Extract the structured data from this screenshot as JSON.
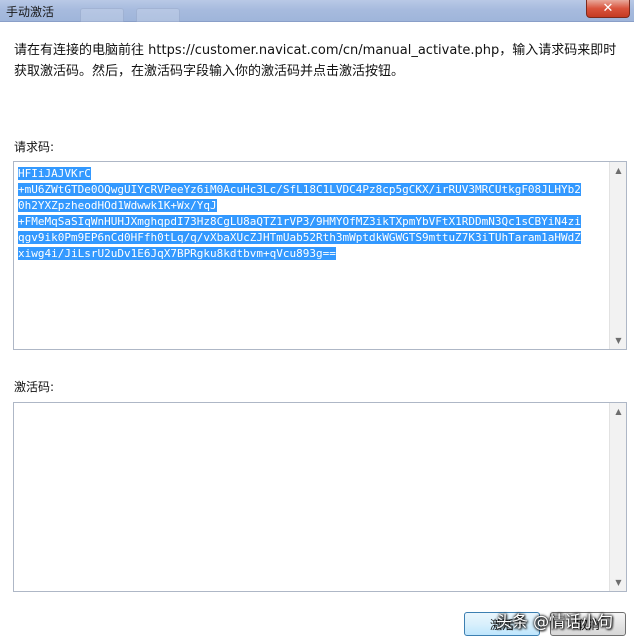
{
  "window": {
    "title": "手动激活",
    "close_glyph": "✕"
  },
  "instruction": "请在有连接的电脑前往 https://customer.navicat.com/cn/manual_activate.php，输入请求码来即时获取激活码。然后，在激活码字段输入你的激活码并点击激活按钮。",
  "request_code": {
    "label": "请求码:",
    "lines": [
      "HFIiJAJVKrC",
      "+mU6ZWtGTDe0OQwgUIYcRVPeeYz6iM0AcuHc3Lc/SfL18C1LVDC4Pz8cp5gCKX/irRUV3MRCUtkgF08JLHYb2",
      "0h2YXZpzheodHOd1Wdwwk1K+Wx/YqJ",
      "+FMeMqSaSIqWnHUHJXmghqpdI73Hz8CgLU8aQTZ1rVP3/9HMYOfMZ3ikTXpmYbVFtX1RDDmN3Qc1sCBYiN4zi",
      "qgv9ik0Pm9EP6nCd0HFfh0tLq/q/vXbaXUcZJHTmUab52Rth3mWptdkWGWGTS9mttuZ7K3iTUhTaram1aHWdZ",
      "xiwg4i/JiLsrU2uDv1E6JqX7BPRgku8kdtbvm+qVcu893g=="
    ]
  },
  "activation_code": {
    "label": "激活码:",
    "value": ""
  },
  "buttons": {
    "activate": "激活",
    "cancel": "取消"
  },
  "watermark": "头条 @情话小句",
  "colors": {
    "selection": "#3399ff",
    "titlebar": "#a7bbde",
    "close": "#d9533c"
  }
}
